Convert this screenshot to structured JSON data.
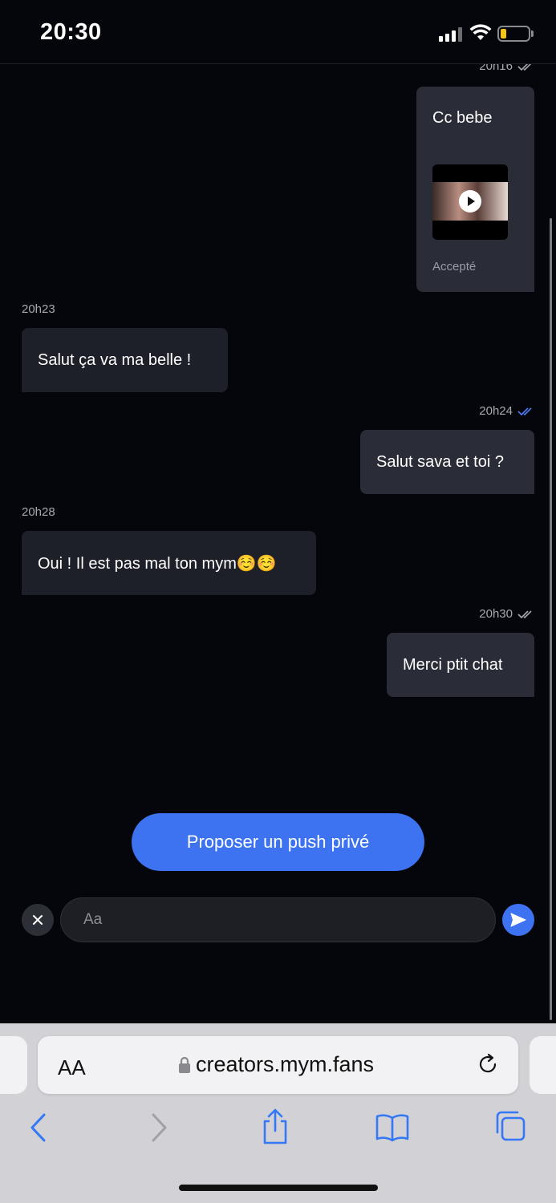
{
  "status_bar": {
    "time": "20:30"
  },
  "messages": [
    {
      "timestamp": "20h16",
      "direction": "out",
      "read": false
    },
    {
      "media": {
        "text": "Cc bebe",
        "status": "Accepté"
      }
    },
    {
      "timestamp": "20h23",
      "direction": "in",
      "text": "Salut ça va ma belle !"
    },
    {
      "timestamp": "20h24",
      "direction": "out",
      "read": true,
      "text": "Salut sava et toi ?"
    },
    {
      "timestamp": "20h28",
      "direction": "in",
      "text": "Oui ! Il est pas mal ton mym☺️☺️"
    },
    {
      "timestamp": "20h30",
      "direction": "out",
      "read": false,
      "text": "Merci ptit chat"
    }
  ],
  "actions": {
    "push_label": "Proposer un push privé"
  },
  "composer": {
    "placeholder": "Aa"
  },
  "browser": {
    "text_size_label": "AA",
    "url": "creators.mym.fans"
  },
  "colors": {
    "accent": "#3d73f0",
    "background": "#05060b",
    "bubble_out": "#2a2d37",
    "bubble_in": "#1e2029",
    "read_tick": "#4f7cf5",
    "unread_tick": "#a7a9b0"
  },
  "icons": [
    "signal-icon",
    "wifi-icon",
    "battery-icon",
    "double-check-icon",
    "play-icon",
    "close-icon",
    "send-icon",
    "lock-icon",
    "reload-icon",
    "back-icon",
    "forward-icon",
    "share-icon",
    "bookmarks-icon",
    "tabs-icon"
  ]
}
